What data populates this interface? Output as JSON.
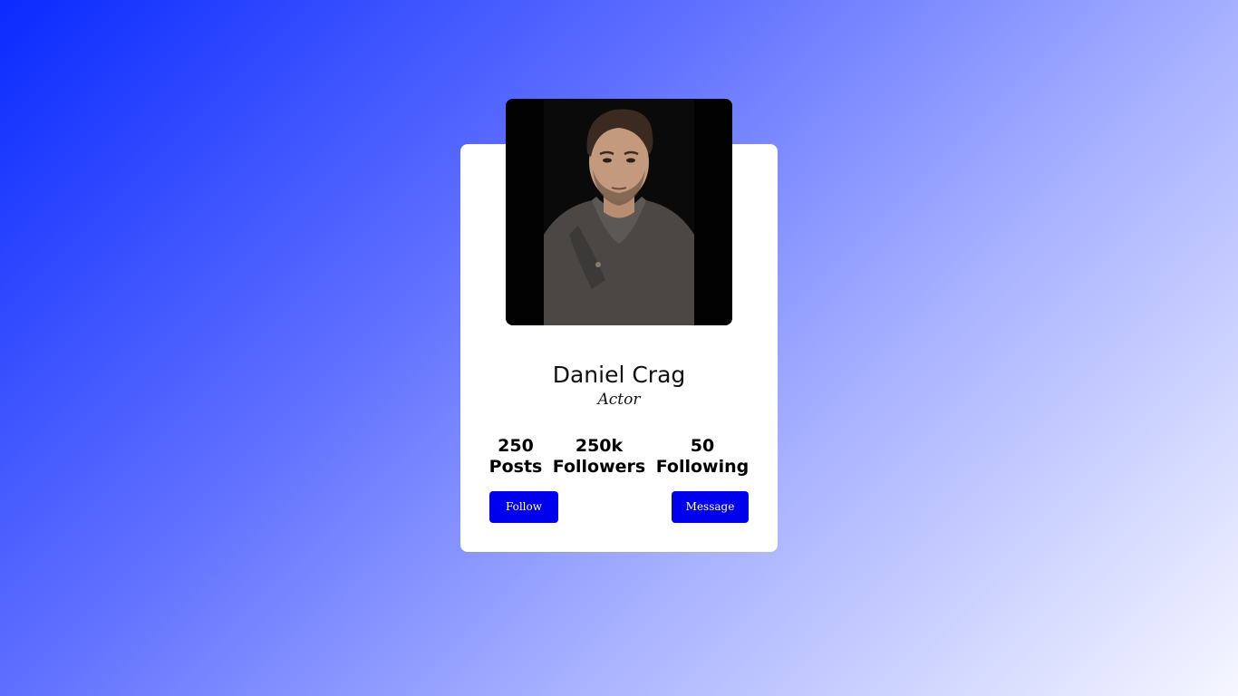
{
  "profile": {
    "name": "Daniel Crag",
    "role": "Actor",
    "photo_icon": "profile-photo"
  },
  "stats": [
    {
      "value": "250",
      "label": "Posts"
    },
    {
      "value": "250k",
      "label": "Followers"
    },
    {
      "value": "50",
      "label": "Following"
    }
  ],
  "actions": {
    "follow_label": "Follow",
    "message_label": "Message"
  },
  "colors": {
    "button": "#0000ee",
    "card": "#ffffff",
    "gradient_start": "#0a2aff",
    "gradient_end": "#f6f7ff"
  }
}
